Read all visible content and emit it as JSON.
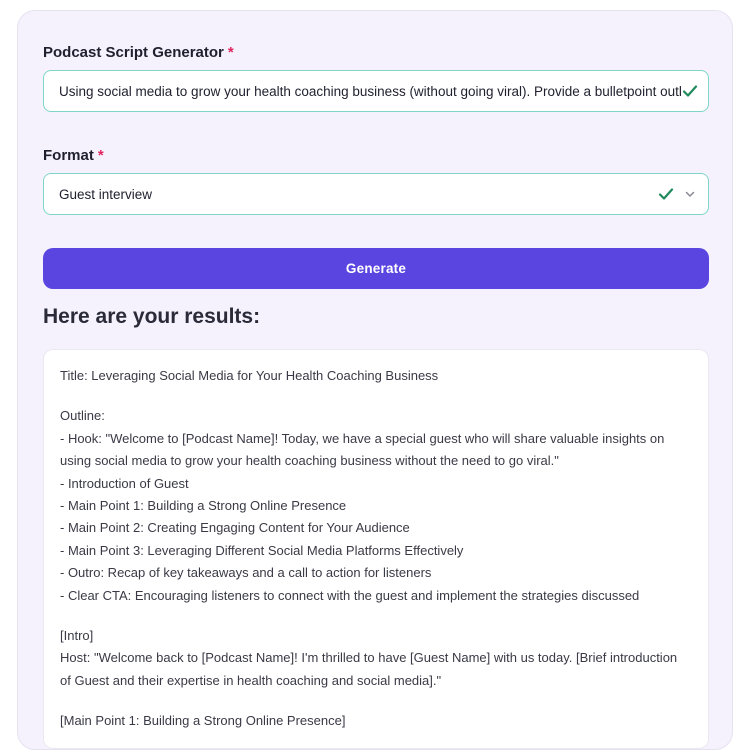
{
  "form": {
    "topic_label": "Podcast Script Generator",
    "topic_required": "*",
    "topic_value": "Using social media to grow your health coaching business (without going viral). Provide a bulletpoint outline co",
    "format_label": "Format",
    "format_required": "*",
    "format_value": "Guest interview",
    "generate_label": "Generate"
  },
  "results": {
    "heading": "Here are your results:",
    "title_line": "Title: Leveraging Social Media for Your Health Coaching Business",
    "outline_label": "Outline:",
    "outline_items": [
      "- Hook: \"Welcome to [Podcast Name]! Today, we have a special guest who will share valuable insights on",
      "using social media to grow your health coaching business without the need to go viral.\"",
      "- Introduction of Guest",
      "- Main Point 1: Building a Strong Online Presence",
      "- Main Point 2: Creating Engaging Content for Your Audience",
      "- Main Point 3: Leveraging Different Social Media Platforms Effectively",
      "- Outro: Recap of key takeaways and a call to action for listeners",
      "- Clear CTA: Encouraging listeners to connect with the guest and implement the strategies discussed"
    ],
    "intro_label": "[Intro]",
    "intro_lines": [
      "Host: \"Welcome back to [Podcast Name]! I'm thrilled to have [Guest Name] with us today. [Brief introduction",
      "of Guest and their expertise in health coaching and social media].\""
    ],
    "main_point_label": "[Main Point 1: Building a Strong Online Presence]"
  },
  "colors": {
    "accent": "#5a45e0",
    "valid_border": "#7fd6c8",
    "check": "#1f8a5b",
    "required": "#e0245e"
  },
  "icons": {
    "valid": "check-icon",
    "dropdown": "chevron-down-icon"
  }
}
